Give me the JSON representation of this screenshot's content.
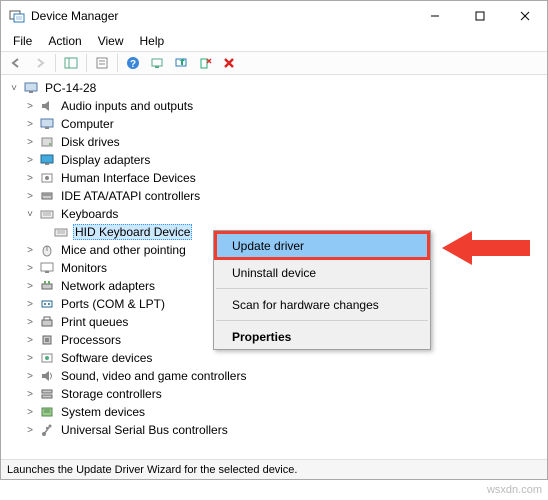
{
  "titlebar": {
    "title": "Device Manager"
  },
  "menubar": {
    "file": "File",
    "action": "Action",
    "view": "View",
    "help": "Help"
  },
  "tree": {
    "root": "PC-14-28",
    "items": [
      {
        "label": "Audio inputs and outputs",
        "icon": "speaker"
      },
      {
        "label": "Computer",
        "icon": "computer"
      },
      {
        "label": "Disk drives",
        "icon": "disk"
      },
      {
        "label": "Display adapters",
        "icon": "display"
      },
      {
        "label": "Human Interface Devices",
        "icon": "hid"
      },
      {
        "label": "IDE ATA/ATAPI controllers",
        "icon": "ide"
      },
      {
        "label": "Keyboards",
        "icon": "keyboard",
        "expanded": true,
        "children": [
          {
            "label": "HID Keyboard Device",
            "icon": "keyboard",
            "selected": true
          }
        ]
      },
      {
        "label": "Mice and other pointing",
        "icon": "mouse"
      },
      {
        "label": "Monitors",
        "icon": "monitor"
      },
      {
        "label": "Network adapters",
        "icon": "network"
      },
      {
        "label": "Ports (COM & LPT)",
        "icon": "port"
      },
      {
        "label": "Print queues",
        "icon": "printer"
      },
      {
        "label": "Processors",
        "icon": "cpu"
      },
      {
        "label": "Software devices",
        "icon": "software"
      },
      {
        "label": "Sound, video and game controllers",
        "icon": "sound"
      },
      {
        "label": "Storage controllers",
        "icon": "storage"
      },
      {
        "label": "System devices",
        "icon": "system"
      },
      {
        "label": "Universal Serial Bus controllers",
        "icon": "usb"
      }
    ]
  },
  "context_menu": {
    "update": "Update driver",
    "uninstall": "Uninstall device",
    "scan": "Scan for hardware changes",
    "properties": "Properties"
  },
  "statusbar": {
    "text": "Launches the Update Driver Wizard for the selected device."
  },
  "watermark": "wsxdn.com",
  "colors": {
    "highlight": "#cce8ff",
    "menu_hover": "#90c8f6",
    "callout": "#ef3d2f"
  }
}
